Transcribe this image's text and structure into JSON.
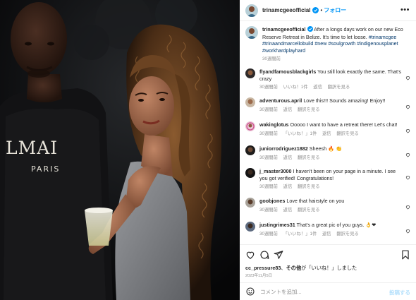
{
  "post": {
    "image_alt": "Photo of a man in a black shirt and a woman with curly hair at night",
    "shirt_text_1": "LMAI",
    "shirt_text_2": "PARIS"
  },
  "header": {
    "username": "trinamcgeeofficial",
    "separator": "•",
    "follow_label": "フォロー",
    "more_label": "•••",
    "verified_icon": "verified-badge-icon"
  },
  "caption": {
    "username": "trinamcgeeofficial",
    "text": "After a longs days work on our new Eco Reserve Retreat in Belize. It's time to let loose.",
    "hashtags": "#trinamcgee #trinaandmarcellobuild #new #soulgrowth #indigenousplanet #workhardplayhard",
    "time": "30週間前"
  },
  "comments": [
    {
      "user": "flyandfamousblackgirls",
      "text": "You still look exactly the same. That's crazy",
      "time": "30週間前",
      "likes": "いいね！1件",
      "reply": "返信",
      "translate": "翻訳を見る"
    },
    {
      "user": "adventurous.april",
      "text": "Love this!!! Sounds amazing! Enjoy!!",
      "time": "30週間前",
      "likes": "",
      "reply": "返信",
      "translate": "翻訳を見る"
    },
    {
      "user": "wakinglotus",
      "text": "Ooooo I want to have a retreat there! Let's chat!",
      "time": "30週間前",
      "likes": "「いいね！」1件",
      "reply": "返信",
      "translate": "翻訳を見る"
    },
    {
      "user": "juniorrodriguez1882",
      "text": "Sheesh 🔥 👏",
      "time": "30週間前",
      "likes": "",
      "reply": "返信",
      "translate": "翻訳を見る"
    },
    {
      "user": "j_master3000",
      "text": "I haven't been on your page in a minute. I see you got verified! Congratulations!",
      "time": "30週間前",
      "likes": "",
      "reply": "返信",
      "translate": "翻訳を見る"
    },
    {
      "user": "goobjones",
      "text": "Love that hairstyle on you",
      "time": "30週間前",
      "likes": "",
      "reply": "返信",
      "translate": "翻訳を見る"
    },
    {
      "user": "justingrimes31",
      "text": "That's a great pic of you guys. 👌❤",
      "time": "30週間前",
      "likes": "「いいね！」1件",
      "reply": "返信",
      "translate": "翻訳を見る"
    }
  ],
  "actions": {
    "like_icon": "heart-icon",
    "comment_icon": "comment-icon",
    "share_icon": "send-icon",
    "save_icon": "bookmark-icon"
  },
  "likes": {
    "user": "cc_pressure83",
    "middle": "、",
    "others": "その他",
    "suffix": "が「いいね！」しました"
  },
  "date": "2023年11月5日",
  "composer": {
    "placeholder": "コメントを追加...",
    "post_label": "投稿する",
    "emoji_icon": "emoji-icon"
  },
  "colors": {
    "accent": "#0095f6",
    "muted": "#8e8e8e",
    "link": "#00376b",
    "post_disabled": "#b2dffc"
  }
}
